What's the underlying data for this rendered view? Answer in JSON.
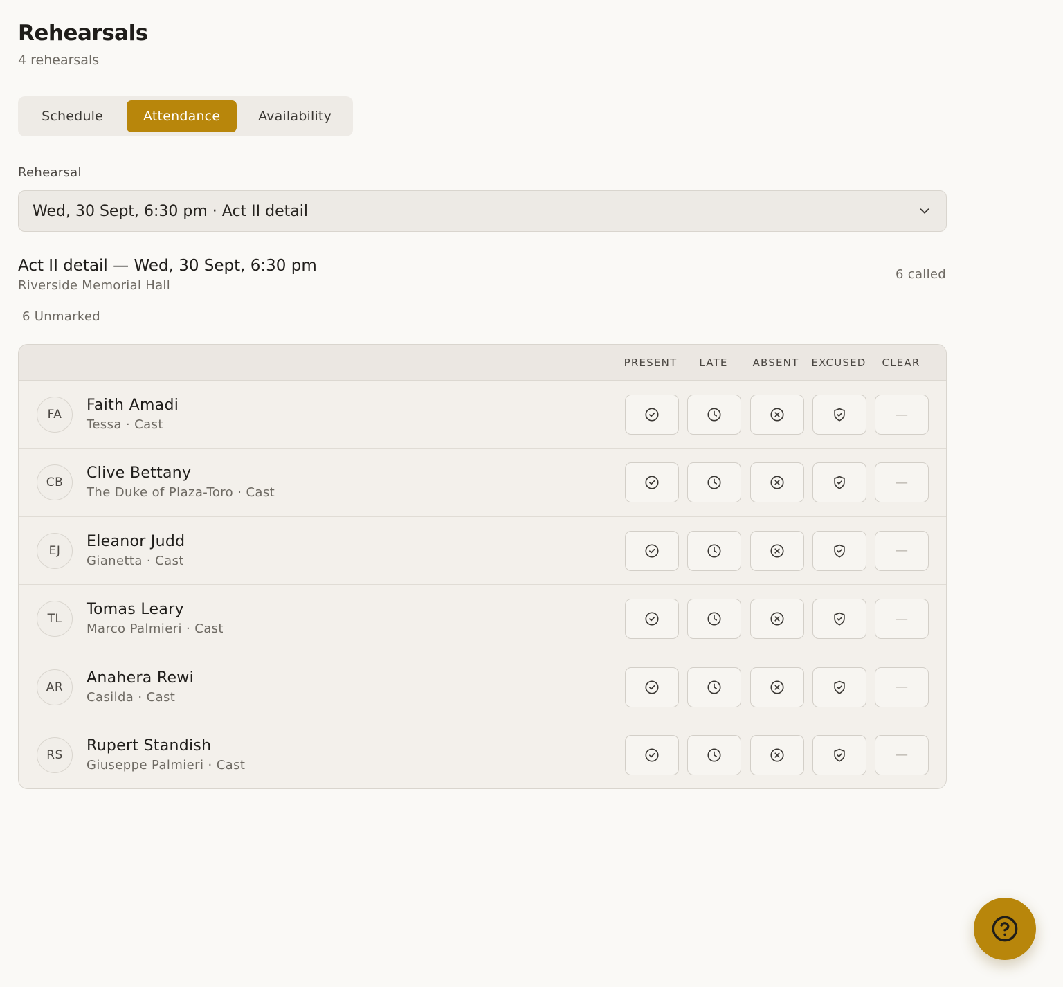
{
  "header": {
    "title": "Rehearsals",
    "subtitle": "4 rehearsals"
  },
  "tabs": [
    {
      "label": "Schedule",
      "active": false
    },
    {
      "label": "Attendance",
      "active": true
    },
    {
      "label": "Availability",
      "active": false
    }
  ],
  "rehearsal_select": {
    "label": "Rehearsal",
    "value": "Wed, 30 Sept, 6:30 pm · Act II detail",
    "icon": "chevron-down-icon"
  },
  "session": {
    "title": "Act II detail — Wed, 30 Sept, 6:30 pm",
    "venue": "Riverside Memorial Hall",
    "called": "6 called",
    "unmarked": "6 Unmarked"
  },
  "columns": [
    "PRESENT",
    "LATE",
    "ABSENT",
    "EXCUSED",
    "CLEAR"
  ],
  "roster": [
    {
      "initials": "FA",
      "name": "Faith Amadi",
      "role": "Tessa · Cast"
    },
    {
      "initials": "CB",
      "name": "Clive Bettany",
      "role": "The Duke of Plaza-Toro · Cast"
    },
    {
      "initials": "EJ",
      "name": "Eleanor Judd",
      "role": "Gianetta · Cast"
    },
    {
      "initials": "TL",
      "name": "Tomas Leary",
      "role": "Marco Palmieri · Cast"
    },
    {
      "initials": "AR",
      "name": "Anahera Rewi",
      "role": "Casilda · Cast"
    },
    {
      "initials": "RS",
      "name": "Rupert Standish",
      "role": "Giuseppe Palmieri · Cast"
    }
  ],
  "clear_symbol": "—",
  "icons": {
    "present": "check-circle-icon",
    "late": "clock-icon",
    "absent": "x-circle-icon",
    "excused": "shield-check-icon",
    "help": "help-circle-icon"
  },
  "colors": {
    "accent": "#b8860b",
    "background": "#faf9f6",
    "surface": "#f3f0eb"
  }
}
